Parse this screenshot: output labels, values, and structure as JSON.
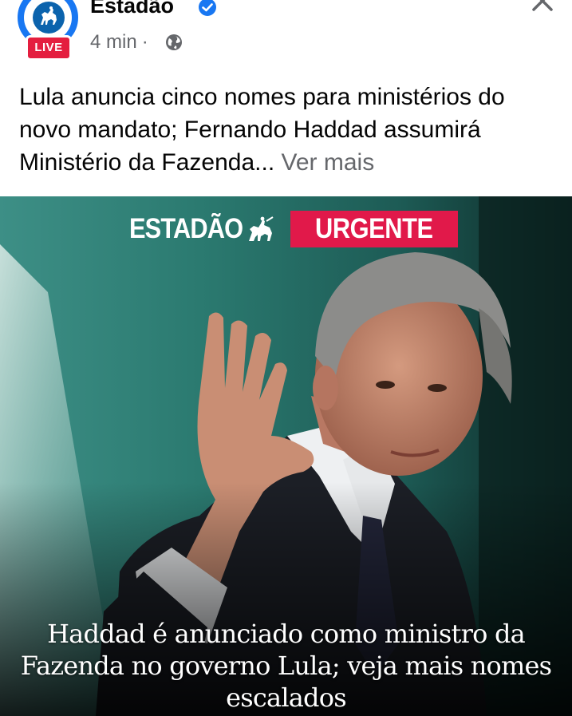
{
  "post": {
    "page_name": "Estadão",
    "live_label": "LIVE",
    "time": "4 min",
    "separator": "·",
    "privacy_icon": "globe-icon",
    "verified_icon": "verified-badge-icon",
    "more_icon": "more-options-icon",
    "close_icon": "close-icon",
    "caption": "Lula anuncia cinco nomes para ministérios do novo mandato; Fernando Haddad assumirá Ministério da Fazenda...",
    "see_more": "Ver mais"
  },
  "image": {
    "brand": "ESTADÃO",
    "tag": "URGENTE",
    "headline": "Haddad é anunciado como ministro da Fazenda no governo Lula; veja mais nomes escalados"
  },
  "colors": {
    "facebook_blue": "#1877f2",
    "live_red": "#e41e3f",
    "urgent_red": "#e1194a",
    "meta_gray": "#65676b",
    "text_dark": "#050505"
  }
}
